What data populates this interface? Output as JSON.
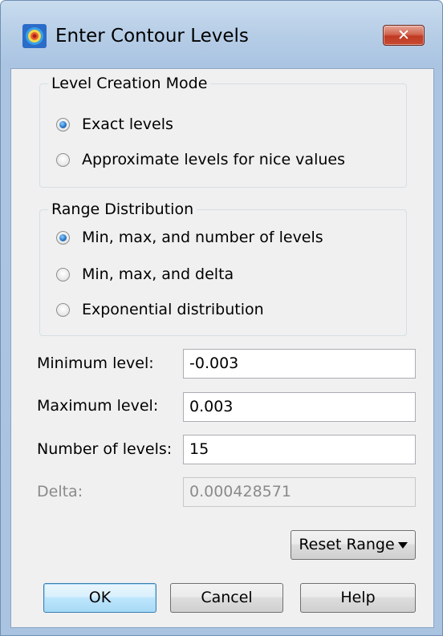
{
  "window": {
    "title": "Enter Contour Levels",
    "close_label": "✕"
  },
  "level_creation_mode": {
    "title": "Level Creation Mode",
    "options": [
      {
        "label": "Exact levels",
        "selected": true
      },
      {
        "label": "Approximate levels for nice values",
        "selected": false
      }
    ]
  },
  "range_distribution": {
    "title": "Range Distribution",
    "options": [
      {
        "label": "Min, max, and number of levels",
        "selected": true
      },
      {
        "label": "Min, max, and delta",
        "selected": false
      },
      {
        "label": "Exponential distribution",
        "selected": false
      }
    ]
  },
  "fields": {
    "minimum": {
      "label": "Minimum level:",
      "value": "-0.003"
    },
    "maximum": {
      "label": "Maximum level:",
      "value": "0.003"
    },
    "number": {
      "label": "Number of levels:",
      "value": "15"
    },
    "delta": {
      "label": "Delta:",
      "value": "0.000428571",
      "disabled": true
    }
  },
  "buttons": {
    "reset_range": "Reset Range",
    "ok": "OK",
    "cancel": "Cancel",
    "help": "Help"
  },
  "icons": {
    "app": "contour-app-icon",
    "close": "close-icon",
    "reset_dropdown": "caret-down-icon"
  }
}
